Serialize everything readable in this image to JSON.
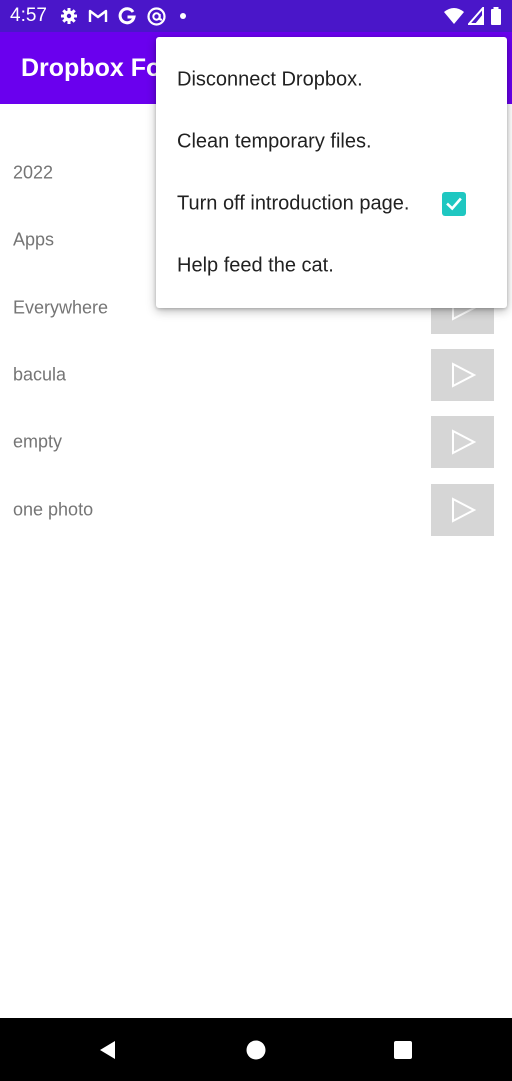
{
  "status_bar": {
    "time": "4:57",
    "icons": [
      "gear-icon",
      "gmail-icon",
      "google-icon",
      "at-sign-icon",
      "dot-icon",
      "wifi-icon",
      "signal-icon",
      "battery-icon"
    ]
  },
  "app_bar": {
    "title": "Dropbox Fo"
  },
  "folders": [
    {
      "label": "2022"
    },
    {
      "label": "Apps"
    },
    {
      "label": "Everywhere"
    },
    {
      "label": "bacula"
    },
    {
      "label": "empty"
    },
    {
      "label": "one photo"
    }
  ],
  "overflow_menu": {
    "items": [
      {
        "label": "Disconnect Dropbox."
      },
      {
        "label": "Clean temporary files."
      },
      {
        "label": "Turn off introduction page.",
        "checked": true
      },
      {
        "label": "Help feed the cat."
      }
    ]
  },
  "nav_bar": {
    "buttons": [
      "back-icon",
      "home-icon",
      "recents-icon"
    ]
  },
  "colors": {
    "status_bar": "#4a16c9",
    "app_bar": "#6a00ee",
    "checkbox": "#1fc7c1",
    "play_button_bg": "#d6d6d6",
    "folder_text": "#757575"
  }
}
